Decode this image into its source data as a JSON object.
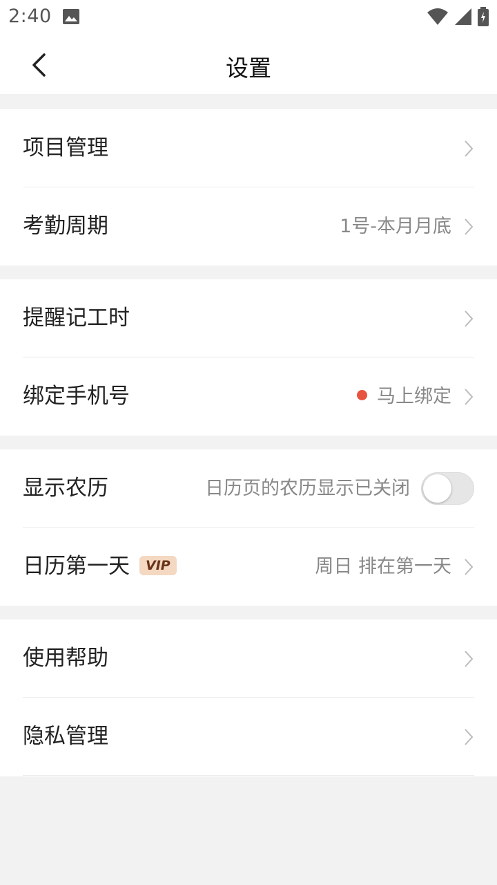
{
  "status_bar": {
    "time": "2:40",
    "icons": [
      "image-icon",
      "wifi-icon",
      "signal-icon",
      "battery-icon"
    ]
  },
  "header": {
    "title": "设置",
    "back_icon": "chevron-left-icon"
  },
  "groups": [
    {
      "items": [
        {
          "label": "项目管理",
          "value": ""
        },
        {
          "label": "考勤周期",
          "value": "1号-本月月底"
        }
      ]
    },
    {
      "items": [
        {
          "label": "提醒记工时",
          "value": ""
        },
        {
          "label": "绑定手机号",
          "value": "马上绑定",
          "dot_color": "#e8533f"
        }
      ]
    },
    {
      "items": [
        {
          "label": "显示农历",
          "value": "日历页的农历显示已关闭",
          "toggle_on": false
        },
        {
          "label": "日历第一天",
          "badge": "VIP",
          "value": "周日 排在第一天"
        }
      ]
    },
    {
      "items": [
        {
          "label": "使用帮助",
          "value": ""
        },
        {
          "label": "隐私管理",
          "value": ""
        }
      ]
    }
  ],
  "colors": {
    "background": "#f2f2f2",
    "card": "#ffffff",
    "accent_dot": "#e8533f",
    "vip_bg": "#f4d8c2",
    "vip_text": "#6a3418"
  }
}
